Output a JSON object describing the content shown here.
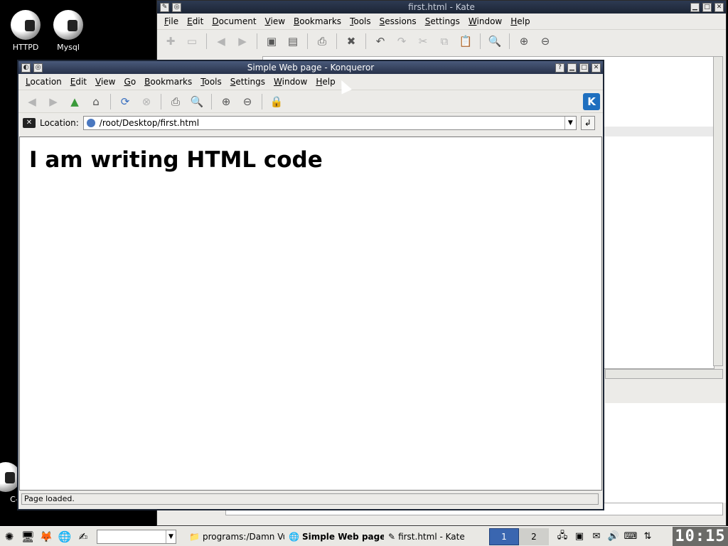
{
  "desktop": {
    "icons": [
      {
        "label": "HTTPD"
      },
      {
        "label": "Mysql"
      },
      {
        "label": "C-"
      }
    ]
  },
  "kate": {
    "title": "first.html - Kate",
    "menu": [
      "File",
      "Edit",
      "Document",
      "View",
      "Bookmarks",
      "Tools",
      "Sessions",
      "Settings",
      "Window",
      "Help"
    ]
  },
  "konqueror": {
    "title": "Simple Web page - Konqueror",
    "menu": [
      "Location",
      "Edit",
      "View",
      "Go",
      "Bookmarks",
      "Tools",
      "Settings",
      "Window",
      "Help"
    ],
    "location_label": "Location:",
    "location_value": "/root/Desktop/first.html",
    "page_heading": "I am writing HTML code",
    "status": "Page loaded."
  },
  "taskbar": {
    "tasks": [
      {
        "label": "programs:/Damn Vuln"
      },
      {
        "label": "Simple Web page -"
      },
      {
        "label": "first.html - Kate"
      }
    ],
    "pager": [
      "1",
      "2"
    ],
    "clock": "10:15"
  }
}
